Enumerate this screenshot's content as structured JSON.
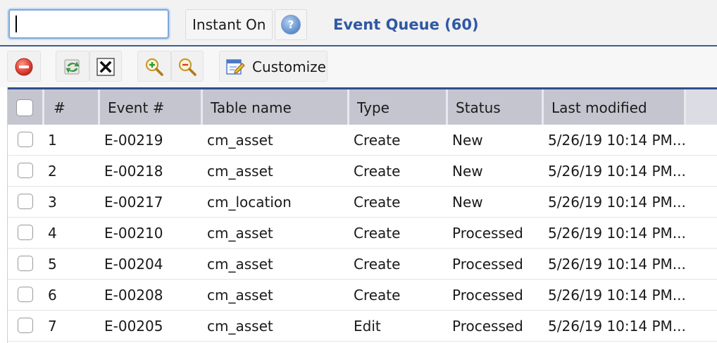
{
  "search": {
    "value": "",
    "placeholder": ""
  },
  "header": {
    "instant_label": "Instant On",
    "help_icon": "question-icon",
    "queue_title": "Event Queue (60)"
  },
  "toolbar": {
    "delete_icon": "delete-icon",
    "refresh_icon": "refresh-icon",
    "clear_icon": "clear-icon",
    "zoom_in_icon": "zoom-in-icon",
    "zoom_out_icon": "zoom-out-icon",
    "customize_label": "Customize"
  },
  "table": {
    "columns": [
      "#",
      "Event #",
      "Table name",
      "Type",
      "Status",
      "Last modified"
    ],
    "rows": [
      {
        "num": "1",
        "event": "E-00219",
        "table": "cm_asset",
        "type": "Create",
        "status": "New",
        "modified": "5/26/19 10:14 PM..."
      },
      {
        "num": "2",
        "event": "E-00218",
        "table": "cm_asset",
        "type": "Create",
        "status": "New",
        "modified": "5/26/19 10:14 PM..."
      },
      {
        "num": "3",
        "event": "E-00217",
        "table": "cm_location",
        "type": "Create",
        "status": "New",
        "modified": "5/26/19 10:14 PM..."
      },
      {
        "num": "4",
        "event": "E-00210",
        "table": "cm_asset",
        "type": "Create",
        "status": "Processed",
        "modified": "5/26/19 10:14 PM..."
      },
      {
        "num": "5",
        "event": "E-00204",
        "table": "cm_asset",
        "type": "Create",
        "status": "Processed",
        "modified": "5/26/19 10:14 PM..."
      },
      {
        "num": "6",
        "event": "E-00208",
        "table": "cm_asset",
        "type": "Create",
        "status": "Processed",
        "modified": "5/26/19 10:14 PM..."
      },
      {
        "num": "7",
        "event": "E-00205",
        "table": "cm_asset",
        "type": "Edit",
        "status": "Processed",
        "modified": "5/26/19 10:14 PM..."
      }
    ]
  },
  "colors": {
    "accent": "#2f58a4",
    "header_bg": "#c5c5d0",
    "header_border": "#2f4f8e"
  }
}
